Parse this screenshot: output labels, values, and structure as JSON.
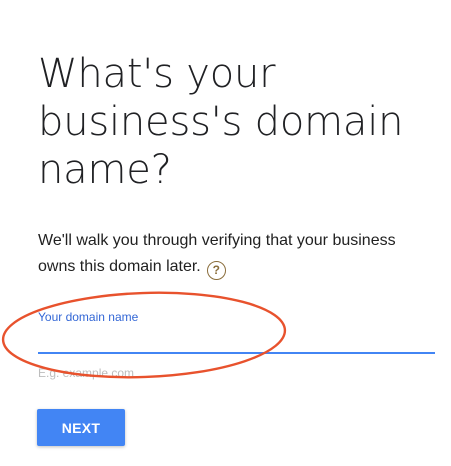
{
  "main": {
    "title": "What's your business's domain name?",
    "description": "We'll walk you through verifying that your business owns this domain later.",
    "help_icon": "question-mark-circle-icon",
    "domain_field": {
      "label": "Your domain name",
      "value": "",
      "hint": "E.g. example.com"
    },
    "next_label": "NEXT"
  },
  "colors": {
    "accent": "#4285f4",
    "label": "#3367d6",
    "help_icon": "#8a6d3b",
    "annotation": "#e8522d"
  }
}
